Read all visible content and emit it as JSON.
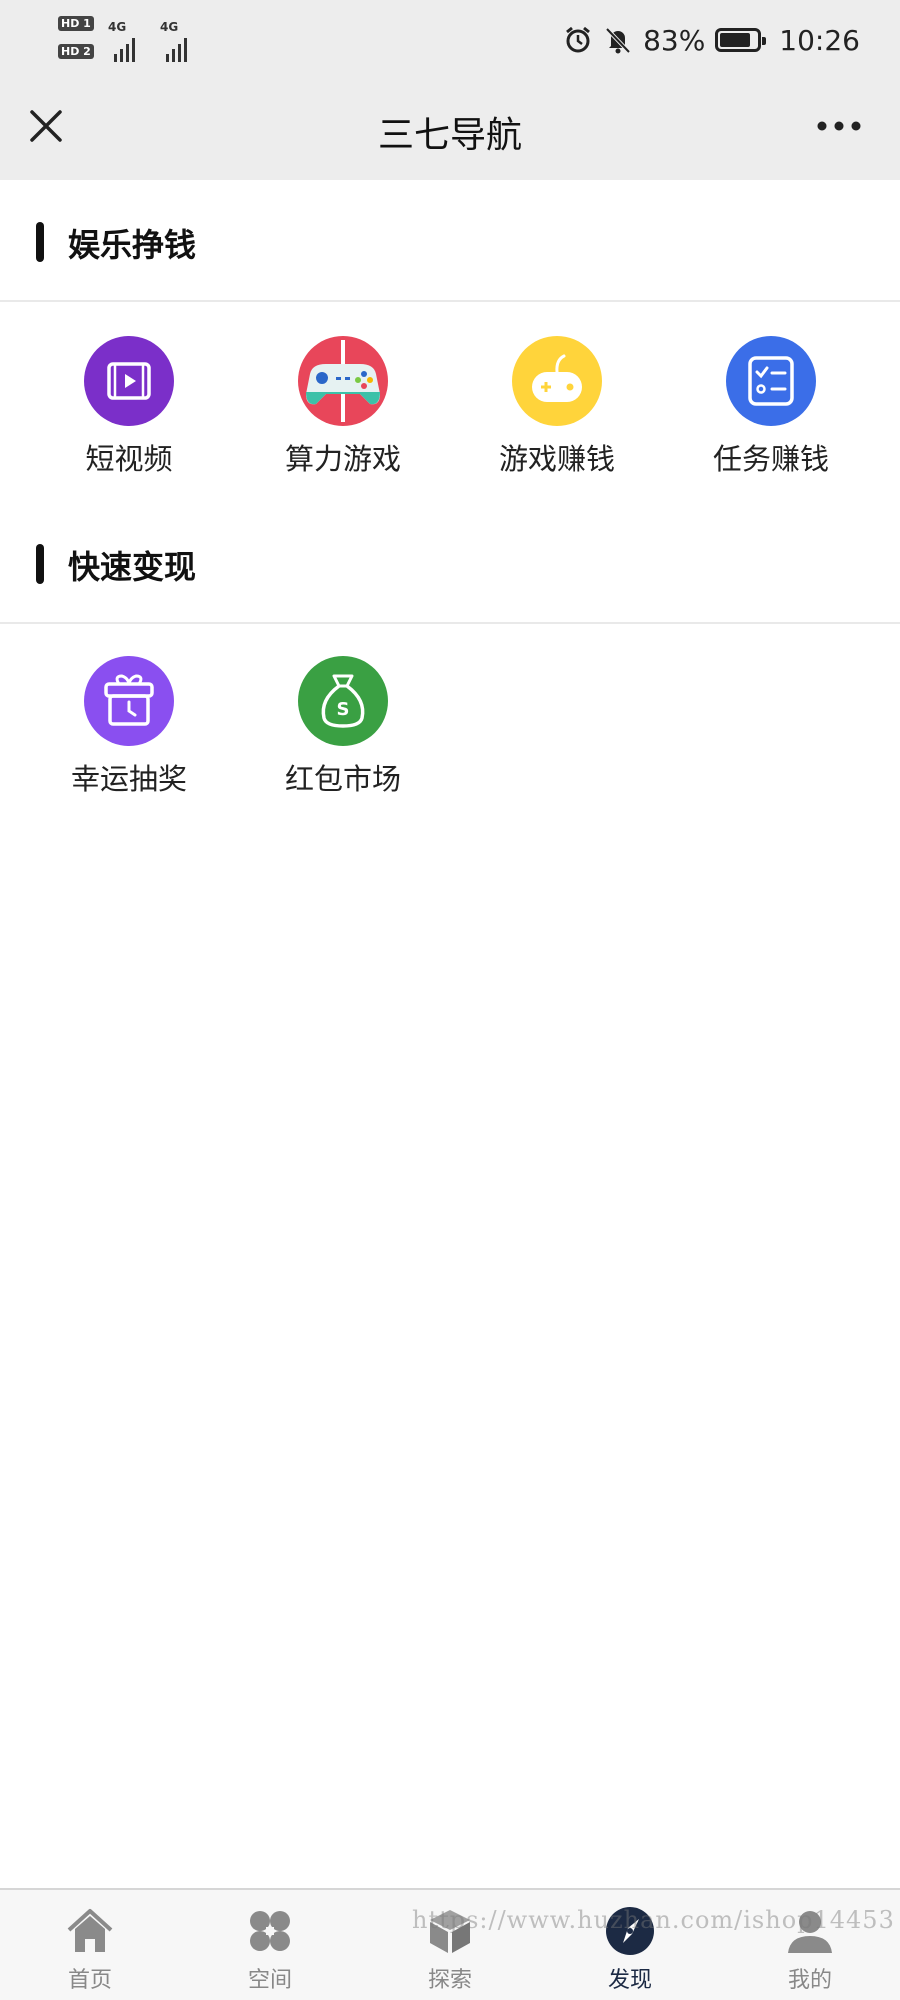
{
  "status_bar": {
    "sim1": "HD 1",
    "sim2": "HD 2",
    "net1": "4G",
    "net2": "4G",
    "battery_pct": "83%",
    "battery_level": 0.83,
    "time": "10:26"
  },
  "nav": {
    "title": "三七导航",
    "close_icon": "close-icon",
    "more_icon": "more-icon"
  },
  "sections": [
    {
      "title": "娱乐挣钱",
      "items": [
        {
          "label": "短视频",
          "icon": "video-icon",
          "color": "#7b2fc9"
        },
        {
          "label": "算力游戏",
          "icon": "gamepad-icon",
          "color": "#e8465a"
        },
        {
          "label": "游戏赚钱",
          "icon": "joystick-icon",
          "color": "#ffd43b"
        },
        {
          "label": "任务赚钱",
          "icon": "checklist-icon",
          "color": "#3b6ee8"
        }
      ]
    },
    {
      "title": "快速变现",
      "items": [
        {
          "label": "幸运抽奖",
          "icon": "gift-icon",
          "color": "#8a4ff0"
        },
        {
          "label": "红包市场",
          "icon": "money-bag-icon",
          "color": "#3aa043"
        }
      ]
    }
  ],
  "tabbar": [
    {
      "label": "首页",
      "icon": "home-icon"
    },
    {
      "label": "空间",
      "icon": "clover-icon"
    },
    {
      "label": "探索",
      "icon": "cube-icon"
    },
    {
      "label": "发现",
      "icon": "compass-icon",
      "active": true
    },
    {
      "label": "我的",
      "icon": "user-icon"
    }
  ],
  "watermark": "https://www.huzhan.com/ishop14453",
  "colors": {
    "topbar": "#ededed",
    "tab_active": "#1c2a44",
    "tab_inactive": "#888888"
  }
}
